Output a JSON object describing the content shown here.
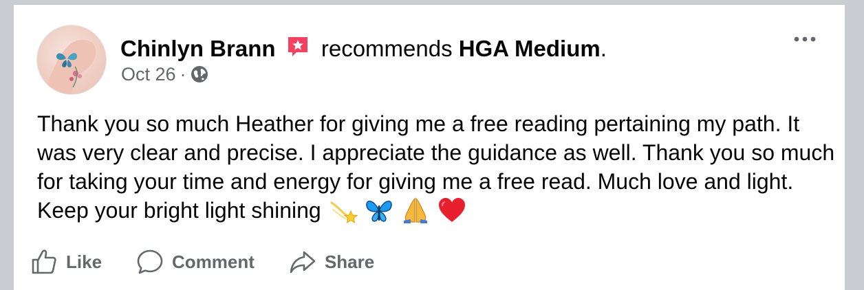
{
  "post": {
    "author": "Chinlyn Brann",
    "action_text": "recommends",
    "page_name": "HGA Medium",
    "page_suffix": ".",
    "date": "Oct 26",
    "separator": "·",
    "privacy_icon": "globe-icon",
    "body": "Thank you so much Heather for giving me a free reading pertaining my path. It was very clear and precise. I appreciate the guidance as well. Thank you so much for taking your time and energy for giving me a free read. Much love and light. Keep your bright light shining",
    "emojis": [
      "dizzy-star-emoji",
      "butterfly-emoji",
      "folded-hands-emoji",
      "red-heart-emoji"
    ]
  },
  "actions": {
    "like": "Like",
    "comment": "Comment",
    "share": "Share"
  },
  "colors": {
    "text": "#050505",
    "secondary": "#65676b",
    "recommend_badge": "#f3425f",
    "background": "#c9ccd1"
  }
}
